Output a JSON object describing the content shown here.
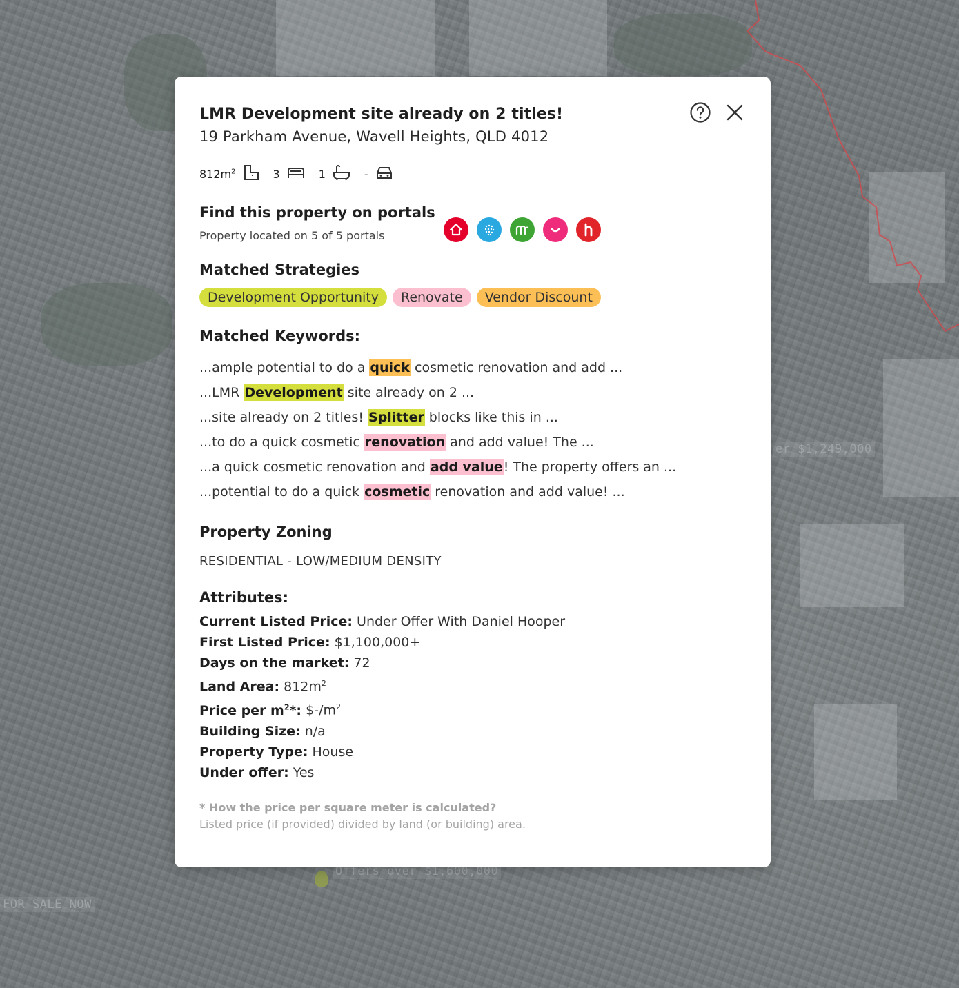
{
  "map": {
    "labels": [
      "er $1,249,000",
      "Offers over $1,600,000",
      "FOR SALE NOW"
    ],
    "boundary_color": "#e0434a"
  },
  "modal": {
    "title": "LMR Development site already on 2 titles!",
    "address": "19 Parkham Avenue, Wavell Heights, QLD 4012",
    "features": {
      "land_area": "812m",
      "land_area_sup": "2",
      "bedrooms": "3",
      "bathrooms": "1",
      "parking": "-",
      "icons": [
        "land-area-icon",
        "bed-icon",
        "bath-icon",
        "car-icon"
      ]
    },
    "portals": {
      "heading": "Find this property on portals",
      "subtext": "Property located on 5 of 5 portals",
      "items": [
        {
          "name": "realestate-portal-icon",
          "color": "#e4002b"
        },
        {
          "name": "domain-portal-icon",
          "color": "#2aa8e0"
        },
        {
          "name": "allhomes-portal-icon",
          "color": "#3ea535"
        },
        {
          "name": "homely-portal-icon",
          "color": "#ee2c7b"
        },
        {
          "name": "homesales-portal-icon",
          "color": "#e0242a"
        }
      ]
    },
    "strategies": {
      "heading": "Matched Strategies",
      "chips": [
        {
          "label": "Development Opportunity",
          "color": "#d4df3d"
        },
        {
          "label": "Renovate",
          "color": "#fbbfcf"
        },
        {
          "label": "Vendor Discount",
          "color": "#fbbf55"
        }
      ]
    },
    "keywords": {
      "heading": "Matched Keywords:",
      "lines": [
        {
          "before": "...ample potential to do a ",
          "match": "quick",
          "after": " cosmetic renovation and add ...",
          "color": "#fbbf55"
        },
        {
          "before": "...LMR ",
          "match": "Development",
          "after": " site already on 2 ...",
          "color": "#d4df3d"
        },
        {
          "before": "...site already on 2 titles! ",
          "match": "Splitter",
          "after": " blocks like this in ...",
          "color": "#d4df3d"
        },
        {
          "before": "...to do a quick cosmetic ",
          "match": "renovation",
          "after": " and add value! The ...",
          "color": "#fbbfcf"
        },
        {
          "before": "...a quick cosmetic renovation and ",
          "match": "add value",
          "after": "! The property offers an ...",
          "color": "#fbbfcf"
        },
        {
          "before": "...potential to do a quick ",
          "match": "cosmetic",
          "after": " renovation and add value! ...",
          "color": "#fbbfcf"
        }
      ]
    },
    "zoning": {
      "heading": "Property Zoning",
      "value": "RESIDENTIAL - LOW/MEDIUM DENSITY"
    },
    "attributes": {
      "heading": "Attributes:",
      "current_listed_price_label": "Current Listed Price:",
      "current_listed_price": "Under Offer With Daniel Hooper",
      "first_listed_price_label": "First Listed Price:",
      "first_listed_price": "$1,100,000+",
      "days_on_market_label": "Days on the market:",
      "days_on_market": "72",
      "land_area_label": "Land Area:",
      "land_area": "812m",
      "price_per_m_label": "Price per m",
      "price_per_m_label_suffix": "*:",
      "price_per_m": "$-/m",
      "building_size_label": "Building Size:",
      "building_size": "n/a",
      "property_type_label": "Property Type:",
      "property_type": "House",
      "under_offer_label": "Under offer:",
      "under_offer": "Yes",
      "sup": "2"
    },
    "footnote": {
      "question": "* How the price per square meter is calculated?",
      "answer": "Listed price (if provided) divided by land (or building) area."
    }
  }
}
